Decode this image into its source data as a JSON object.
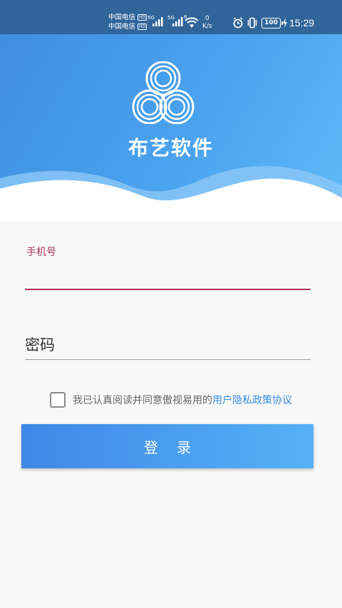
{
  "status_bar": {
    "carrier1": "中国电信",
    "carrier2": "中国电信",
    "hd_label": "HD",
    "sig1_label": "5G",
    "sig2_label": "5G",
    "wifi_label": "6",
    "speed_value": "0",
    "speed_unit": "K/s",
    "battery": "100",
    "time": "15:29",
    "icons": [
      "alarm-icon",
      "vibrate-icon",
      "battery-icon",
      "charging-icon"
    ]
  },
  "header": {
    "brand": "布艺软件",
    "gradient_start": "#3f8ce0",
    "gradient_end": "#5fb9f6"
  },
  "form": {
    "phone_label": "手机号",
    "phone_value": "",
    "password_placeholder": "密码",
    "agreement_text": "我已认真阅读并同意傲视易用的",
    "agreement_link": "用户隐私政策协议",
    "agreement_checked": false,
    "login_button": "登录"
  },
  "colors": {
    "accent_focus": "#a83a60",
    "link": "#3d8fe0",
    "button_start": "#3f87e8",
    "button_end": "#56b2f5"
  }
}
